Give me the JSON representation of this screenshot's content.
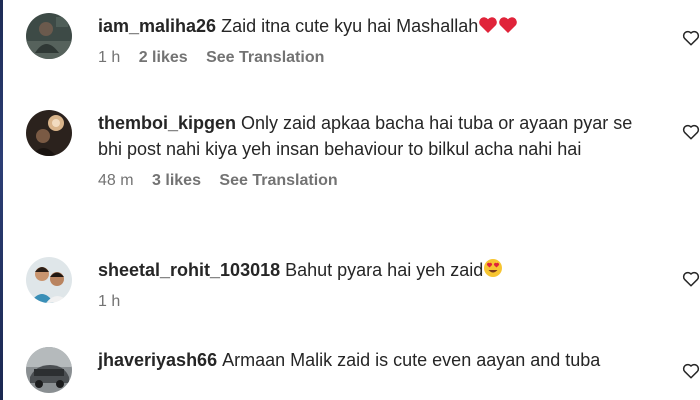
{
  "comments": [
    {
      "username": "iam_maliha26",
      "text": "Zaid itna cute kyu hai Mashallah",
      "emoji": [
        "red-heart",
        "red-heart"
      ],
      "time": "1 h",
      "likes": "2 likes",
      "translation": "See Translation"
    },
    {
      "username": "themboi_kipgen",
      "text": "Only zaid apkaa bacha hai tuba or ayaan pyar se bhi post nahi kiya yeh insan behaviour to bilkul acha nahi hai",
      "emoji": [],
      "time": "48 m",
      "likes": "3 likes",
      "translation": "See Translation"
    },
    {
      "username": "sheetal_rohit_103018",
      "text": "Bahut pyara hai yeh zaid",
      "emoji": [
        "heart-eyes-face"
      ],
      "time": "1 h",
      "likes": "",
      "translation": ""
    },
    {
      "username": "jhaveriyash66",
      "text": "Armaan Malik zaid is cute even aayan and tuba",
      "emoji": [],
      "time": "",
      "likes": "",
      "translation": ""
    }
  ],
  "icons": {
    "like": "heart-outline-icon"
  }
}
